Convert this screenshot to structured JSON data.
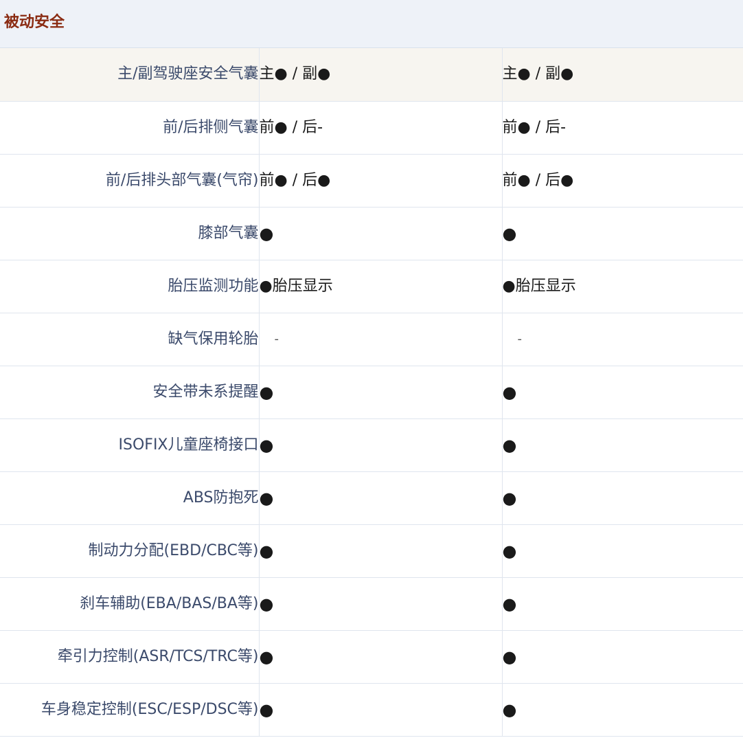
{
  "section": {
    "title": "被动安全"
  },
  "rows": [
    {
      "label": "主/副驾驶座安全气囊",
      "v1": "主● / 副●",
      "v2": "主● / 副●"
    },
    {
      "label": "前/后排侧气囊",
      "v1": "前● / 后-",
      "v2": "前● / 后-"
    },
    {
      "label": "前/后排头部气囊(气帘)",
      "v1": "前● / 后●",
      "v2": "前● / 后●"
    },
    {
      "label": "膝部气囊",
      "v1": "●",
      "v2": "●"
    },
    {
      "label": "胎压监测功能",
      "v1": "●胎压显示",
      "v2": "●胎压显示"
    },
    {
      "label": "缺气保用轮胎",
      "v1": "-",
      "v2": "-"
    },
    {
      "label": "安全带未系提醒",
      "v1": "●",
      "v2": "●"
    },
    {
      "label": "ISOFIX儿童座椅接口",
      "v1": "●",
      "v2": "●"
    },
    {
      "label": "ABS防抱死",
      "v1": "●",
      "v2": "●"
    },
    {
      "label": "制动力分配(EBD/CBC等)",
      "v1": "●",
      "v2": "●"
    },
    {
      "label": "刹车辅助(EBA/BAS/BA等)",
      "v1": "●",
      "v2": "●"
    },
    {
      "label": "牵引力控制(ASR/TCS/TRC等)",
      "v1": "●",
      "v2": "●"
    },
    {
      "label": "车身稳定控制(ESC/ESP/DSC等)",
      "v1": "●",
      "v2": "●"
    }
  ]
}
